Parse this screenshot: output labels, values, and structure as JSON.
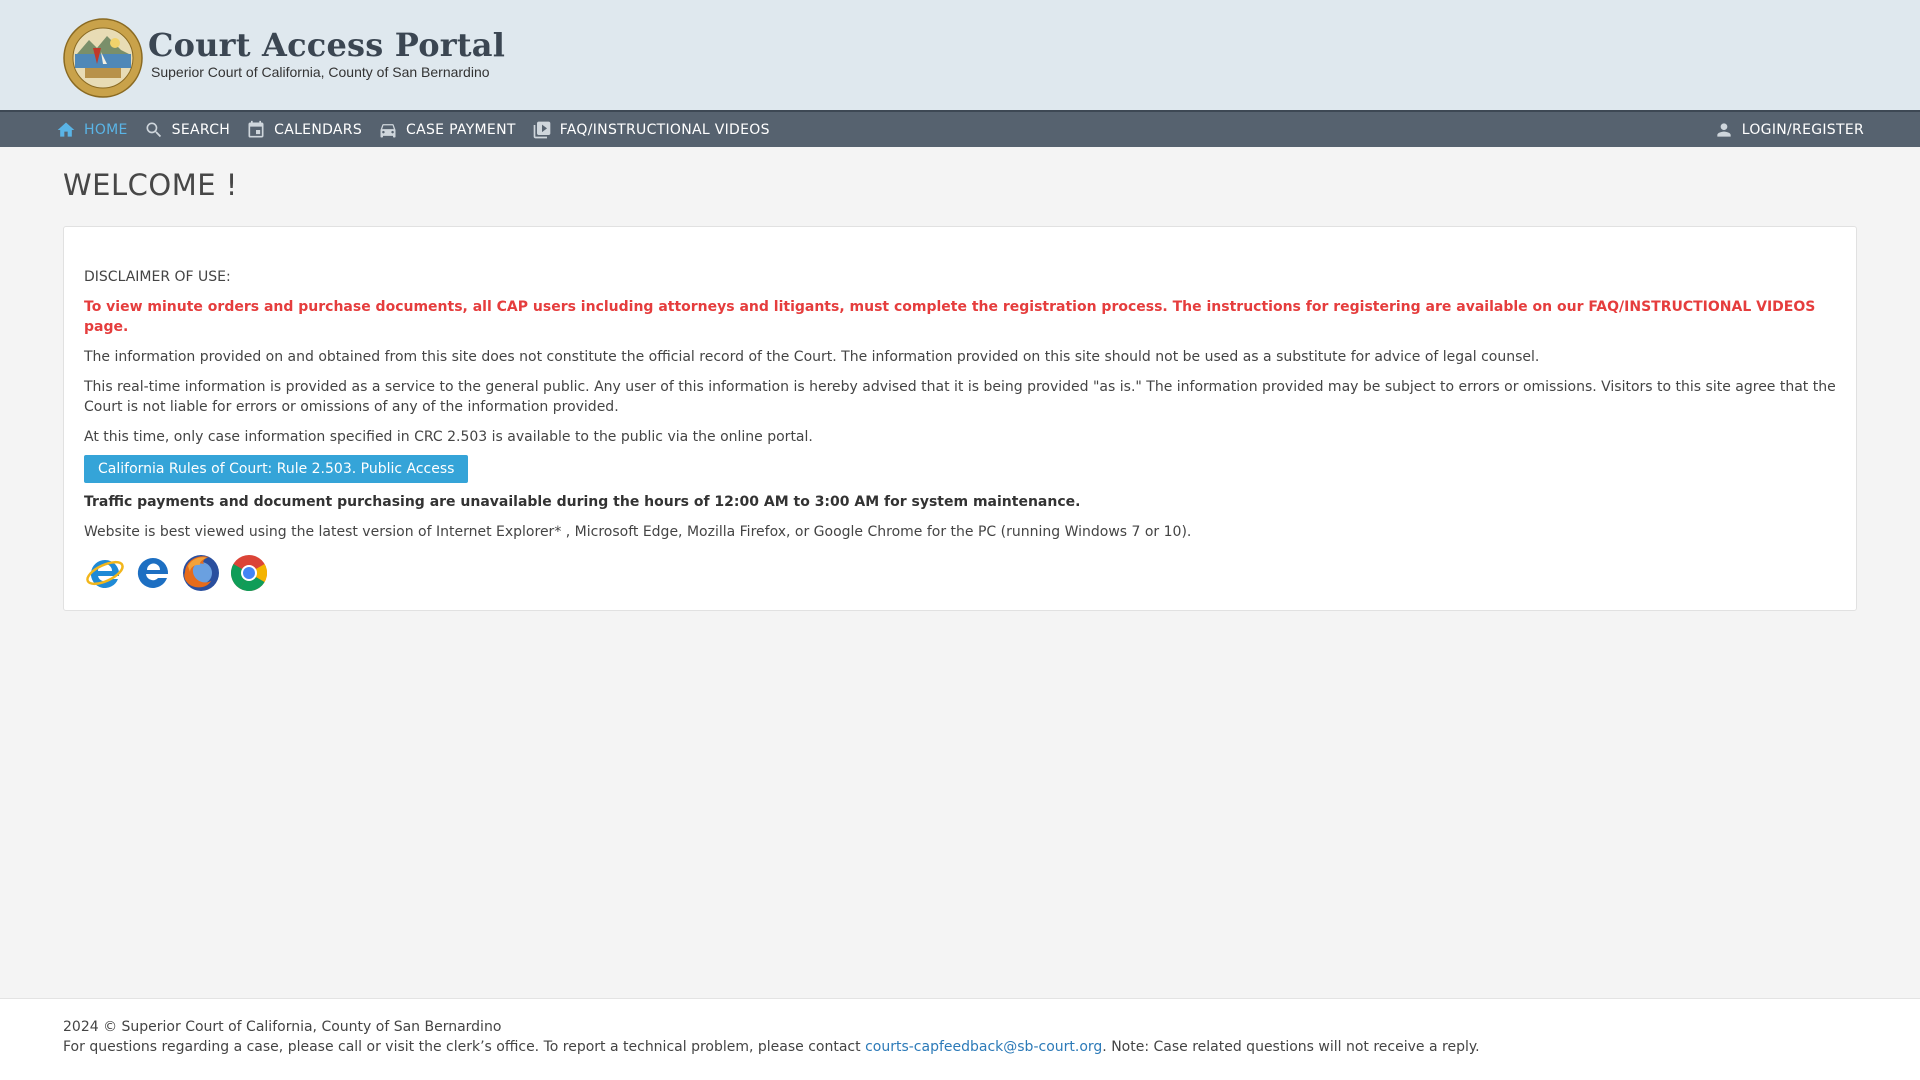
{
  "header": {
    "title": "Court Access Portal",
    "subtitle": "Superior Court of California, County of San Bernardino",
    "seal_text": "SUPERIOR COURT OF CALIFORNIA · COUNTY OF SAN BERNARDINO"
  },
  "nav": {
    "items": [
      {
        "label": "HOME",
        "icon": "home-icon",
        "active": true
      },
      {
        "label": "SEARCH",
        "icon": "search-icon"
      },
      {
        "label": "CALENDARS",
        "icon": "calendar-icon"
      },
      {
        "label": "CASE PAYMENT",
        "icon": "car-icon"
      },
      {
        "label": "FAQ/INSTRUCTIONAL VIDEOS",
        "icon": "video-library-icon"
      }
    ],
    "login": {
      "label": "LOGIN/REGISTER",
      "icon": "person-icon"
    },
    "active_color": "#5ab4e6",
    "bar_color": "#56626f"
  },
  "page": {
    "welcome": "WELCOME !"
  },
  "card": {
    "disclaimer_heading": "DISCLAIMER OF USE:",
    "registration_notice": "To view minute orders and purchase documents, all CAP users including attorneys and litigants, must complete the registration process. The instructions for registering are available on our FAQ/INSTRUCTIONAL VIDEOS page.",
    "official_record": "The information provided on and obtained from this site does not constitute the official record of the Court. The information provided on this site should not be used as a substitute for advice of legal counsel.",
    "real_time": "This real-time information is provided as a service to the general public. Any user of this information is hereby advised that it is being provided \"as is.\" The information provided may be subject to errors or omissions. Visitors to this site agree that the Court is not liable for errors or omissions of any of the information provided.",
    "crc": "At this time, only case information specified in CRC 2.503 is available to the public via the online portal.",
    "rule_button": "California Rules of Court: Rule 2.503. Public Access",
    "maintenance": "Traffic payments and document purchasing are unavailable during the hours of 12:00 AM to 3:00 AM for system maintenance.",
    "browsers_note": "Website is best viewed using the latest version of Internet Explorer* , Microsoft Edge, Mozilla Firefox, or Google Chrome for the PC (running Windows 7 or 10).",
    "browser_icons": [
      "internet-explorer-icon",
      "edge-icon",
      "firefox-icon",
      "chrome-icon"
    ],
    "notice_color": "#e53d3d",
    "button_color": "#35a4d8"
  },
  "footer": {
    "copyright": "2024 © Superior Court of California, County of San Bernardino",
    "contact_prefix": "For questions regarding a case, please call or visit the clerk’s office. To report a technical problem, please contact ",
    "contact_email": "courts-capfeedback@sb-court.org",
    "contact_suffix": ". Note: Case related questions will not receive a reply."
  }
}
